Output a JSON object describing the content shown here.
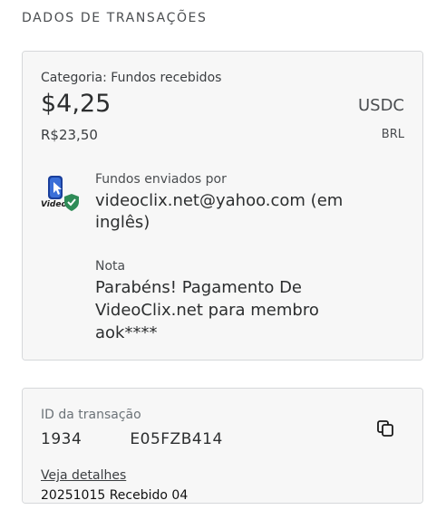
{
  "section": {
    "title": "DADOS DE TRANSAÇÕES"
  },
  "summary": {
    "category": "Categoria: Fundos recebidos",
    "amount": "$4,25",
    "currency": "USDC",
    "local_amount": "R$23,50",
    "local_currency": "BRL"
  },
  "sender": {
    "label": "Fundos enviados por",
    "value": "videoclix.net@yahoo.com (em inglês)",
    "logo_text": "VideoC"
  },
  "note": {
    "label": "Nota",
    "value": "Parabéns! Pagamento De VideoClix.net para membro aok****"
  },
  "transaction": {
    "id_label": "ID da transação",
    "id_value": "1934         E05FZB414",
    "details_link": "Veja detalhes"
  },
  "caption": "20251015 Recebido 04",
  "colors": {
    "card_bg": "#f7f7f7",
    "border": "#d6d8da",
    "verified": "#2e8b57",
    "logo_blue": "#1a3f9c"
  },
  "icons": {
    "copy": "copy-icon",
    "verified": "verified-shield-icon"
  }
}
